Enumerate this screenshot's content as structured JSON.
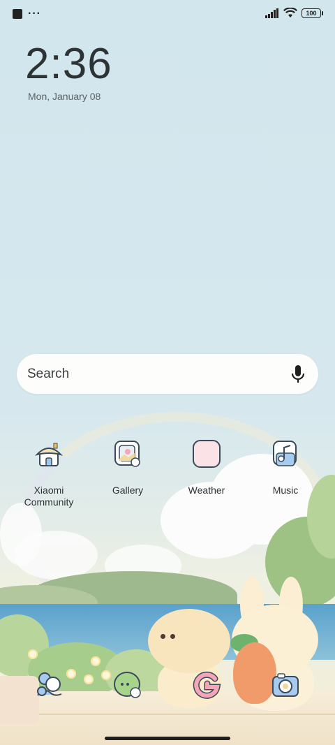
{
  "status_bar": {
    "battery": "100"
  },
  "clock": {
    "time": "2:36",
    "date": "Mon, January 08"
  },
  "search": {
    "placeholder": "Search"
  },
  "apps": [
    {
      "label_line1": "Xiaomi",
      "label_line2": "Community",
      "icon": "house-icon"
    },
    {
      "label": "Gallery",
      "icon": "gallery-icon"
    },
    {
      "label": "Weather",
      "icon": "weather-icon"
    },
    {
      "label": "Music",
      "icon": "music-icon"
    }
  ],
  "dock": [
    "contacts-icon",
    "messages-icon",
    "google-icon",
    "camera-icon"
  ],
  "colors": {
    "accent_pink": "#f4a5b8",
    "sky": "#d5e7ec"
  }
}
